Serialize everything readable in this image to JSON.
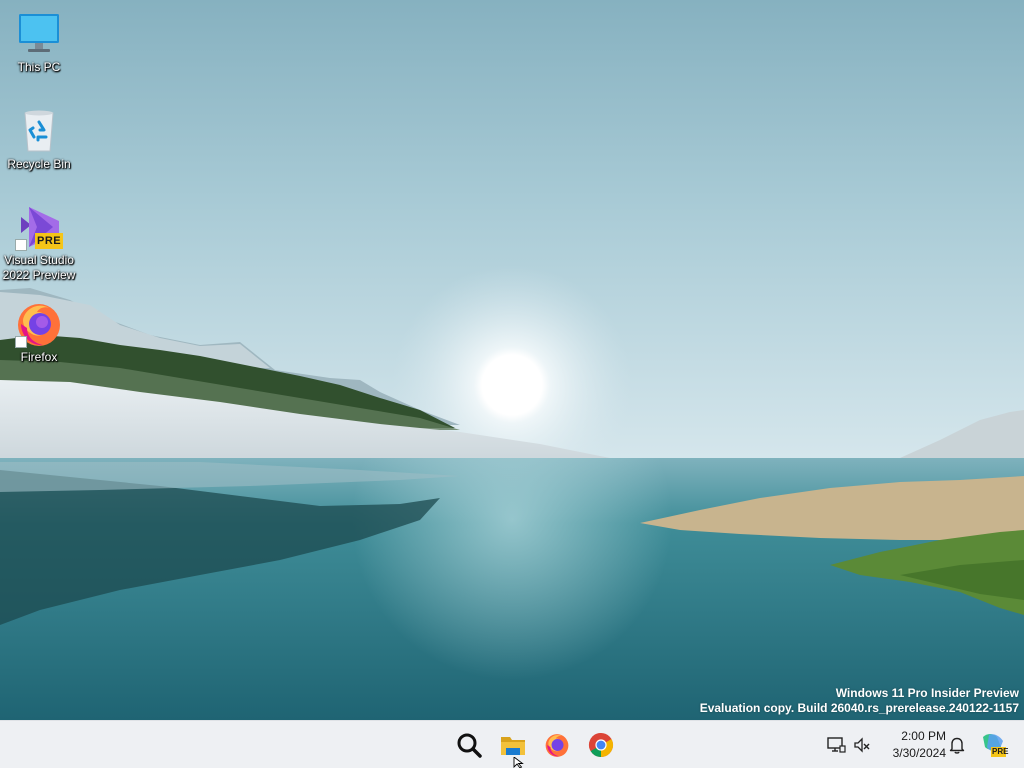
{
  "desktop": {
    "icons": [
      {
        "label": "This PC",
        "icon": "monitor-icon"
      },
      {
        "label": "Recycle Bin",
        "icon": "recycle-bin-icon"
      },
      {
        "label": "Visual Studio\n2022 Preview",
        "icon": "visual-studio-preview-icon",
        "badge": "PRE"
      },
      {
        "label": "Firefox",
        "icon": "firefox-icon"
      }
    ],
    "watermark": {
      "line1": "Windows 11 Pro Insider Preview",
      "line2": "Evaluation copy. Build 26040.rs_prerelease.240122-1157"
    }
  },
  "taskbar": {
    "pinned": [
      {
        "name": "search",
        "icon": "search-icon"
      },
      {
        "name": "file-explorer",
        "icon": "folder-icon"
      },
      {
        "name": "firefox",
        "icon": "firefox-icon"
      },
      {
        "name": "chrome",
        "icon": "chrome-icon"
      }
    ],
    "tray": {
      "icons": [
        "network-icon",
        "volume-muted-icon"
      ],
      "time": "2:00 PM",
      "date": "3/30/2024",
      "notification_icon": "bell-icon",
      "copilot_badge": "PRE"
    }
  },
  "colors": {
    "taskbar_bg": "#eef0f3",
    "vs_purple": "#8a4fd8",
    "pre_badge": "#f5c518",
    "folder_yellow": "#f3c13a"
  }
}
